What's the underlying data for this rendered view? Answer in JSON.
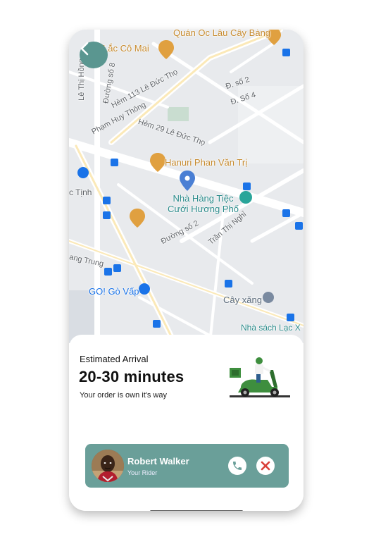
{
  "map": {
    "labels": {
      "quan_oc": "Quán Ốc Lâu Cây Bàng",
      "lac_co_mai": "Lắc Cô Mai",
      "le_thi_hong": "Lê Thị Hồng",
      "duong_so_8": "Đường số 8",
      "hem_113": "Hẻm 113 Lê Đức Thọ",
      "pham_huy_thong": "Phạm Huy Thông",
      "d_so_2_top": "Đ. số 2",
      "d_so_4": "Đ. Số 4",
      "hem_29": "Hẻm 29 Lê Đức Thọ",
      "hanuri": "Hanuri Phan Văn Trị",
      "c_tinh": "c Tịnh",
      "nha_hang": "Nhà Hàng Tiệc\nCưới Hương Phố",
      "duong_so_2": "Đường số 2",
      "tran_thi_nghi": "Trần Thị Nghỉ",
      "ang_trung": "ang Trung",
      "go_go_vap": "GO! Gò Vấp",
      "cay_xang": "Cây xăng",
      "nha_sach": "Nhà sách Lạc X"
    }
  },
  "delivery": {
    "estimated_label": "Estimated Arrival",
    "estimated_time": "20-30 minutes",
    "status": "Your order is own it's way"
  },
  "rider": {
    "name": "Robert Walker",
    "role": "Your Rider"
  },
  "icons": {
    "back": "chevron-left-icon",
    "call": "phone-icon",
    "cancel": "close-icon",
    "pin": "location-pin-icon"
  },
  "colors": {
    "accent": "#5a9690",
    "card": "#6a9f99",
    "cancel_red": "#d9413a",
    "pin_blue": "#4a7fd4",
    "poi_orange": "#e0a040"
  }
}
